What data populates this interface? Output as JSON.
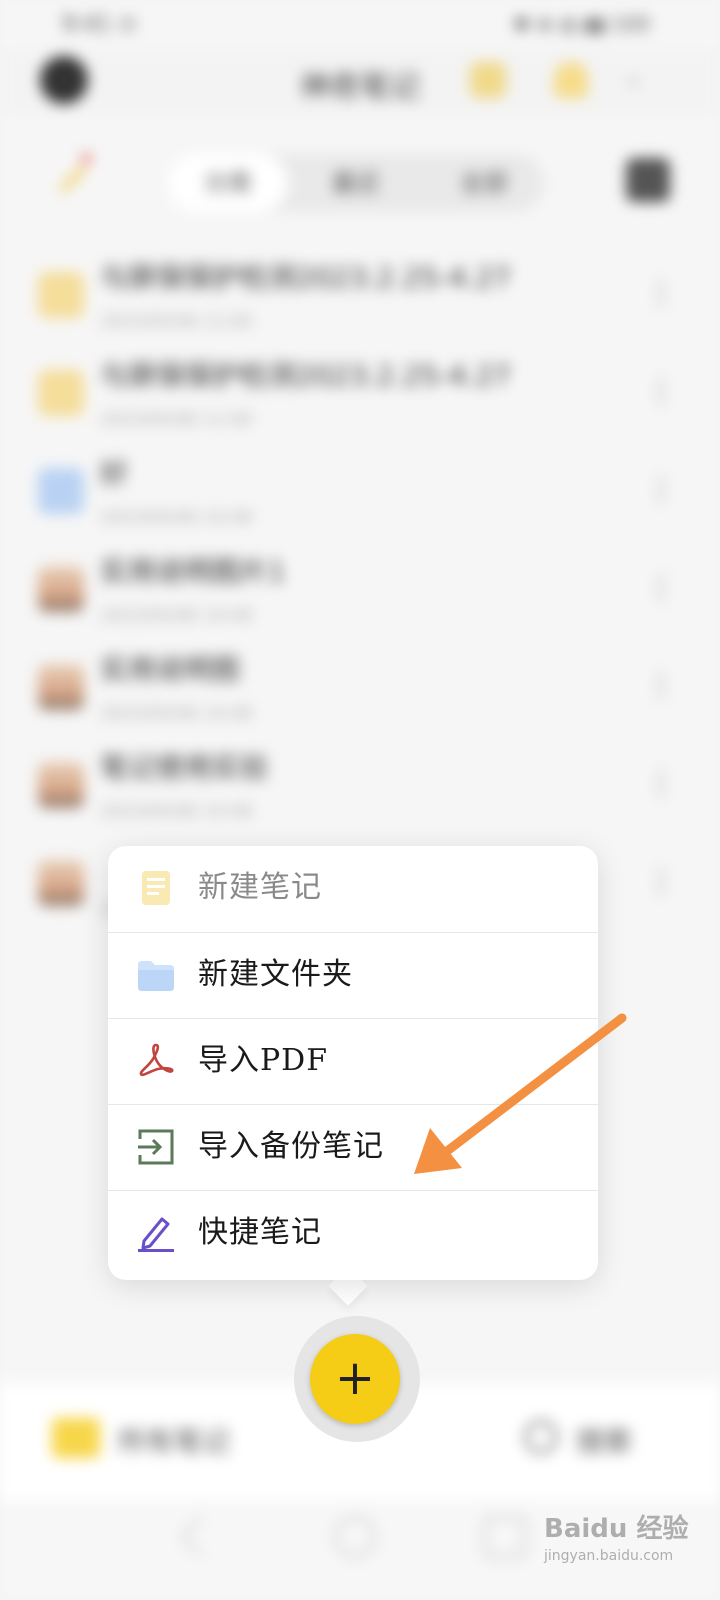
{
  "background_app": {
    "status": {
      "time": "9:41 ⊙",
      "right": "✱ ⊕ ◍ ▮▮ 100"
    },
    "title": "神奇笔记",
    "tabs": [
      "分类",
      "最近",
      "全部"
    ],
    "notes": [
      {
        "title": "与屏保保护检测2023.2.25-4.27",
        "date": "2023/05/06 11:00",
        "icon": "folder-yellow-icon"
      },
      {
        "title": "与屏保保护检测2023.2.25-4.27",
        "date": "2023/05/06 11:00",
        "icon": "folder-yellow-icon"
      },
      {
        "title": "好",
        "date": "2023/05/06 10:48",
        "icon": "folder-blue-icon"
      },
      {
        "title": "实用说明图片1",
        "date": "2023/05/06 10:48",
        "icon": "note-thumbnail-icon"
      },
      {
        "title": "实用说明图",
        "date": "2023/05/06 10:48",
        "icon": "note-thumbnail-icon"
      },
      {
        "title": "笔记使用实验",
        "date": "2023/05/06 10:48",
        "icon": "note-thumbnail-icon"
      },
      {
        "title": "",
        "date": "2023/05/06 10:48",
        "icon": "note-thumbnail-icon"
      }
    ],
    "bottom_nav": {
      "all_notes": "所有笔记",
      "search": "搜索"
    }
  },
  "menu": {
    "items": [
      {
        "label": "新建笔记",
        "icon": "new-note-icon",
        "faded": true
      },
      {
        "label": "新建文件夹",
        "icon": "new-folder-icon"
      },
      {
        "label": "导入PDF",
        "icon": "pdf-icon"
      },
      {
        "label": "导入备份笔记",
        "icon": "import-backup-icon"
      },
      {
        "label": "快捷笔记",
        "icon": "quick-note-pen-icon"
      }
    ]
  },
  "fab": {
    "label": "+"
  },
  "colors": {
    "accent": "#f5cd16",
    "arrow": "#f39041",
    "pdf": "#c0453e",
    "import": "#5a7a5a",
    "pen": "#6a50c8"
  },
  "watermark": {
    "brand": "Baidu 经验",
    "url": "jingyan.baidu.com"
  }
}
